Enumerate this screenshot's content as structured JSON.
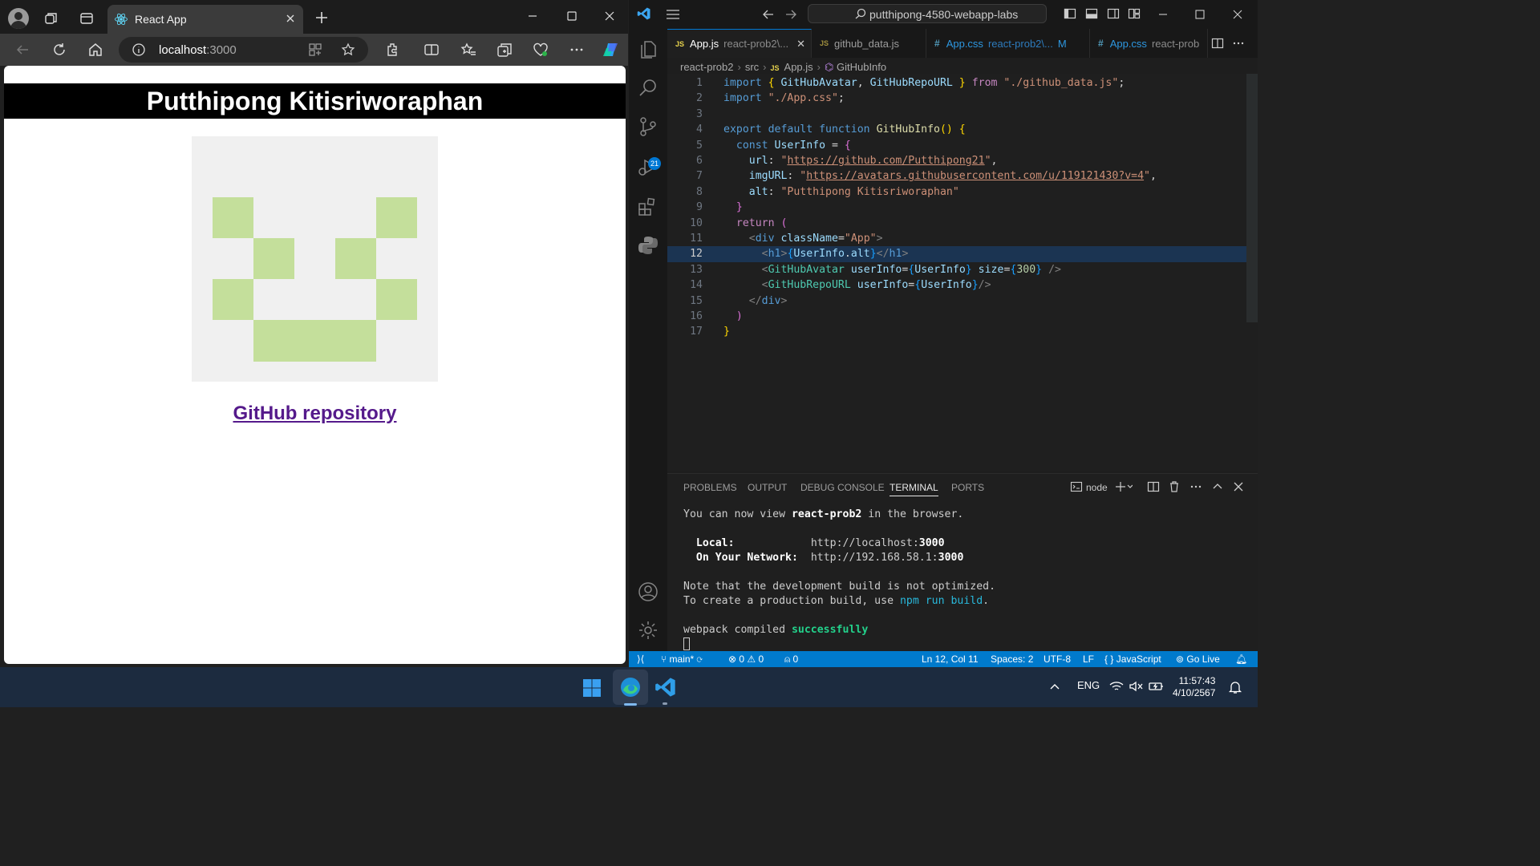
{
  "browser": {
    "tab_title": "React App",
    "url_host": "localhost",
    "url_port": ":3000"
  },
  "webpage": {
    "heading": "Putthipong Kitisriworaphan",
    "link_text": "GitHub repository"
  },
  "vscode": {
    "search_text": "putthipong-4580-webapp-labs",
    "tabs": [
      {
        "label": "App.js",
        "path": "react-prob2\\...",
        "active": true
      },
      {
        "label": "github_data.js",
        "path": "",
        "active": false
      },
      {
        "label": "App.css",
        "path": "react-prob2\\...",
        "mark": "M",
        "active": false
      },
      {
        "label": "App.css",
        "path": "react-prob",
        "active": false
      }
    ],
    "breadcrumb": [
      "react-prob2",
      "src",
      "App.js",
      "GitHubInfo"
    ],
    "scm_badge": "21",
    "panel_tabs": [
      "PROBLEMS",
      "OUTPUT",
      "DEBUG CONSOLE",
      "TERMINAL",
      "PORTS"
    ],
    "terminal_name": "node",
    "terminal": {
      "line1_a": "You can now view ",
      "line1_b": "react-prob2",
      "line1_c": " in the browser.",
      "local_label": "Local:",
      "local_url_a": "http://localhost:",
      "local_url_b": "3000",
      "network_label": "On Your Network:",
      "network_url_a": "http://192.168.58.1:",
      "network_url_b": "3000",
      "note1": "Note that the development build is not optimized.",
      "note2_a": "To create a production build, use ",
      "note2_b": "npm run build",
      "note2_c": ".",
      "compiled_a": "webpack compiled ",
      "compiled_b": "successfully"
    },
    "status": {
      "branch": "main*",
      "errors": "0",
      "warnings": "0",
      "ports": "0",
      "cursor": "Ln 12, Col 11",
      "spaces": "Spaces: 2",
      "encoding": "UTF-8",
      "eol": "LF",
      "language": "JavaScript",
      "golive": "Go Live"
    }
  },
  "code": [
    {
      "n": "1",
      "t": [
        [
          "kw",
          "import "
        ],
        [
          "b1",
          "{ "
        ],
        [
          "va",
          "GitHubAvatar"
        ],
        [
          "pu",
          ", "
        ],
        [
          "va",
          "GitHubRepoURL"
        ],
        [
          "b1",
          " } "
        ],
        [
          "cf",
          "from "
        ],
        [
          "st",
          "\"./github_data.js\""
        ],
        [
          "pu",
          ";"
        ]
      ]
    },
    {
      "n": "2",
      "t": [
        [
          "kw",
          "import "
        ],
        [
          "st",
          "\"./App.css\""
        ],
        [
          "pu",
          ";"
        ]
      ]
    },
    {
      "n": "3",
      "t": []
    },
    {
      "n": "4",
      "t": [
        [
          "kw",
          "export default function "
        ],
        [
          "fn",
          "GitHubInfo"
        ],
        [
          "b1",
          "() {"
        ]
      ]
    },
    {
      "n": "5",
      "t": [
        [
          "pu",
          "  "
        ],
        [
          "kw",
          "const "
        ],
        [
          "va",
          "UserInfo"
        ],
        [
          "pu",
          " = "
        ],
        [
          "b2",
          "{"
        ]
      ]
    },
    {
      "n": "6",
      "t": [
        [
          "pu",
          "    "
        ],
        [
          "va",
          "url"
        ],
        [
          "pu",
          ": "
        ],
        [
          "st",
          "\""
        ],
        [
          "st u",
          "https://github.com/Putthipong21"
        ],
        [
          "st",
          "\""
        ],
        [
          "pu",
          ","
        ]
      ]
    },
    {
      "n": "7",
      "t": [
        [
          "pu",
          "    "
        ],
        [
          "va",
          "imgURL"
        ],
        [
          "pu",
          ": "
        ],
        [
          "st",
          "\""
        ],
        [
          "st u",
          "https://avatars.githubusercontent.com/u/119121430?v=4"
        ],
        [
          "st",
          "\""
        ],
        [
          "pu",
          ","
        ]
      ]
    },
    {
      "n": "8",
      "t": [
        [
          "pu",
          "    "
        ],
        [
          "va",
          "alt"
        ],
        [
          "pu",
          ": "
        ],
        [
          "st",
          "\"Putthipong Kitisriworaphan\""
        ]
      ]
    },
    {
      "n": "9",
      "t": [
        [
          "pu",
          "  "
        ],
        [
          "b2",
          "}"
        ]
      ]
    },
    {
      "n": "10",
      "t": [
        [
          "pu",
          "  "
        ],
        [
          "cf",
          "return "
        ],
        [
          "b2",
          "("
        ]
      ]
    },
    {
      "n": "11",
      "t": [
        [
          "pu",
          "    "
        ],
        [
          "gr",
          "<"
        ],
        [
          "tg",
          "div "
        ],
        [
          "va",
          "className"
        ],
        [
          "pu",
          "="
        ],
        [
          "st",
          "\"App\""
        ],
        [
          "gr",
          ">"
        ]
      ]
    },
    {
      "n": "12",
      "t": [
        [
          "pu",
          "      "
        ],
        [
          "gr",
          "<"
        ],
        [
          "tg",
          "h1"
        ],
        [
          "gr",
          ">"
        ],
        [
          "b3",
          "{"
        ],
        [
          "va",
          "UserInfo"
        ],
        [
          "pu",
          "."
        ],
        [
          "va",
          "alt"
        ],
        [
          "b3",
          "}"
        ],
        [
          "gr",
          "</"
        ],
        [
          "tg",
          "h1"
        ],
        [
          "gr",
          ">"
        ]
      ]
    },
    {
      "n": "13",
      "t": [
        [
          "pu",
          "      "
        ],
        [
          "gr",
          "<"
        ],
        [
          "ty",
          "GitHubAvatar "
        ],
        [
          "va",
          "userInfo"
        ],
        [
          "pu",
          "="
        ],
        [
          "b3",
          "{"
        ],
        [
          "va",
          "UserInfo"
        ],
        [
          "b3",
          "}"
        ],
        [
          "va",
          " size"
        ],
        [
          "pu",
          "="
        ],
        [
          "b3",
          "{"
        ],
        [
          "nu",
          "300"
        ],
        [
          "b3",
          "}"
        ],
        [
          "gr",
          " />"
        ]
      ]
    },
    {
      "n": "14",
      "t": [
        [
          "pu",
          "      "
        ],
        [
          "gr",
          "<"
        ],
        [
          "ty",
          "GitHubRepoURL "
        ],
        [
          "va",
          "userInfo"
        ],
        [
          "pu",
          "="
        ],
        [
          "b3",
          "{"
        ],
        [
          "va",
          "UserInfo"
        ],
        [
          "b3",
          "}"
        ],
        [
          "gr",
          "/>"
        ]
      ]
    },
    {
      "n": "15",
      "t": [
        [
          "pu",
          "    "
        ],
        [
          "gr",
          "</"
        ],
        [
          "tg",
          "div"
        ],
        [
          "gr",
          ">"
        ]
      ]
    },
    {
      "n": "16",
      "t": [
        [
          "pu",
          "  "
        ],
        [
          "b2",
          ")"
        ]
      ]
    },
    {
      "n": "17",
      "t": [
        [
          "b1",
          "}"
        ]
      ]
    }
  ],
  "taskbar": {
    "lang": "ENG",
    "time": "11:57:43",
    "date": "4/10/2567"
  },
  "colors": {
    "vscode_status": "#007acc",
    "avatar_pixel": "#c4df9b",
    "visited_link": "#551a8b"
  }
}
